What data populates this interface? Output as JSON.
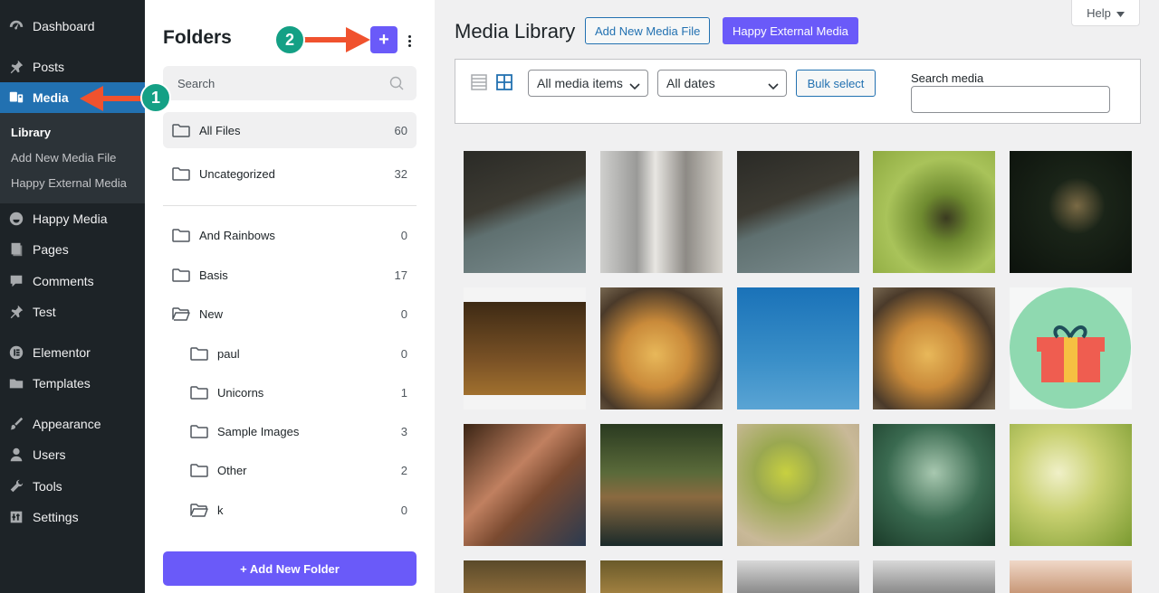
{
  "sidebar": {
    "items": [
      {
        "label": "Dashboard",
        "icon": "dashboard-icon"
      },
      {
        "label": "Posts",
        "icon": "pin-icon"
      },
      {
        "label": "Media",
        "icon": "media-icon"
      },
      {
        "label": "Happy Media",
        "icon": "happy-media-icon"
      },
      {
        "label": "Pages",
        "icon": "pages-icon"
      },
      {
        "label": "Comments",
        "icon": "comments-icon"
      },
      {
        "label": "Test",
        "icon": "pin-icon"
      },
      {
        "label": "Elementor",
        "icon": "elementor-icon"
      },
      {
        "label": "Templates",
        "icon": "folder-icon"
      },
      {
        "label": "Appearance",
        "icon": "brush-icon"
      },
      {
        "label": "Users",
        "icon": "users-icon"
      },
      {
        "label": "Tools",
        "icon": "wrench-icon"
      },
      {
        "label": "Settings",
        "icon": "settings-icon"
      }
    ],
    "submenu": [
      "Library",
      "Add New Media File",
      "Happy External Media"
    ]
  },
  "folders": {
    "title": "Folders",
    "search_placeholder": "Search",
    "top": [
      {
        "name": "All Files",
        "count": "60"
      },
      {
        "name": "Uncategorized",
        "count": "32"
      }
    ],
    "list": [
      {
        "name": "And Rainbows",
        "count": "0"
      },
      {
        "name": "Basis",
        "count": "17"
      },
      {
        "name": "New",
        "count": "0"
      },
      {
        "name": "paul",
        "count": "0"
      },
      {
        "name": "Unicorns",
        "count": "1"
      },
      {
        "name": "Sample Images",
        "count": "3"
      },
      {
        "name": "Other",
        "count": "2"
      },
      {
        "name": "k",
        "count": "0"
      }
    ],
    "add_button": "+ Add New Folder",
    "add_icon": "+"
  },
  "callouts": {
    "one": "1",
    "two": "2"
  },
  "main": {
    "title": "Media Library",
    "add_new": "Add New Media File",
    "happy_external": "Happy External Media",
    "help": "Help",
    "filter_type": "All media items",
    "filter_date": "All dates",
    "bulk_select": "Bulk select",
    "search_label": "Search media"
  },
  "colors": {
    "accent": "#6a5af9",
    "wp_blue": "#2271b1",
    "badge": "#14a085",
    "arrow": "#f0522e"
  }
}
